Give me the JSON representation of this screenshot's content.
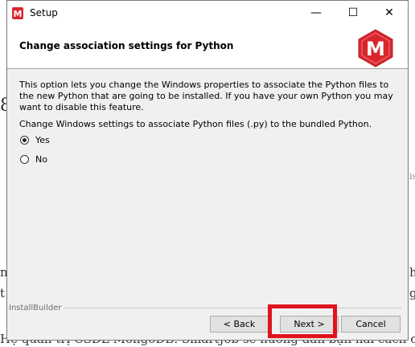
{
  "window": {
    "title": "Setup",
    "controls": [
      "—",
      "☐",
      "✕"
    ]
  },
  "header": {
    "title": "Change association settings for Python",
    "logo_letter": "M"
  },
  "content": {
    "description": "This option lets you change the Windows properties to associate the Python files to the new Python that are going to be installed. If you have your own Python you may want to disable this feature.",
    "question": "Change Windows settings to associate Python files (.py) to the bundled Python.",
    "options": [
      {
        "label": "Yes",
        "selected": true
      },
      {
        "label": "No",
        "selected": false
      }
    ]
  },
  "footer": {
    "brand": "InstallBuilder",
    "back_label": "< Back",
    "next_label": "Next >",
    "cancel_label": "Cancel"
  },
  "background": {
    "bottom_text": "Hệ quản trị CSDL MongoDB. SmartJob sẽ hướng dẫn bạn hai cách cài đặt M",
    "frag_left_1": "8",
    "frag_left_2": "ni",
    "frag_left_3": "t",
    "frag_right_1": "is",
    "frag_right_2": "hì",
    "frag_right_3": "g"
  },
  "colors": {
    "highlight": "#e0141c",
    "logo_red": "#d9262d"
  }
}
